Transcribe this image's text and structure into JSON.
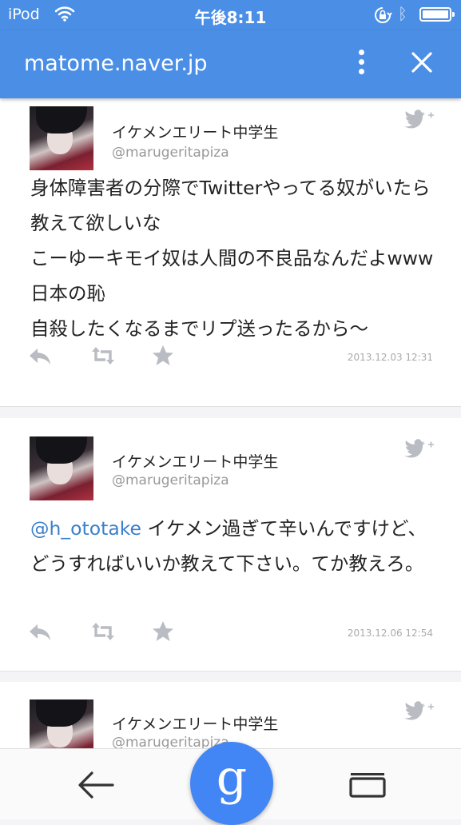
{
  "status_bar": {
    "carrier": "iPod",
    "time": "午後8:11"
  },
  "app_bar": {
    "url": "matome.naver.jp"
  },
  "tweets": [
    {
      "name": "イケメンエリート中学生",
      "handle": "@marugeritapiza",
      "text": "身体障害者の分際でTwitterやってる奴がいたら教えて欲しいな\nこーゆーキモイ奴は人間の不良品なんだよwww日本の恥\n自殺したくなるまでリプ送ったるから〜",
      "date": "2013.12.03 12:31"
    },
    {
      "name": "イケメンエリート中学生",
      "handle": "@marugeritapiza",
      "mention": "@h_ototake",
      "text": " イケメン過ぎて辛いんですけど、どうすればいいか教えて下さい。てか教えろ。",
      "date": "2013.12.06 12:54"
    },
    {
      "name": "イケメンエリート中学生",
      "handle": "@marugeritapiza"
    }
  ],
  "icons": {
    "wifi": "wifi-icon",
    "rotation_lock": "rotation-lock-icon",
    "bluetooth": "bluetooth-icon",
    "battery": "battery-icon",
    "more": "more-vert-icon",
    "close": "close-icon",
    "twitter": "twitter-bird-icon",
    "reply": "reply-icon",
    "retweet": "retweet-icon",
    "favorite": "star-icon",
    "back": "back-arrow-icon",
    "tabs": "tabs-icon",
    "google": "google-g-icon"
  },
  "google_letter": "g",
  "bluetooth_glyph": "ᛒ",
  "colors": {
    "header": "#4a8ee6",
    "link": "#3b80cb",
    "google": "#4285f4"
  }
}
